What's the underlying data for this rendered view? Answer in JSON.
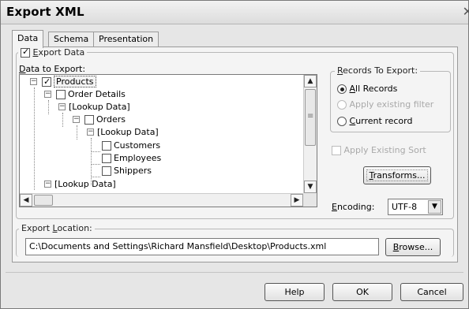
{
  "window": {
    "title": "Export XML",
    "close_glyph": "✕"
  },
  "tabs": [
    {
      "label": "Data",
      "active": true
    },
    {
      "label": "Schema",
      "active": false
    },
    {
      "label": "Presentation",
      "active": false
    }
  ],
  "export_data": {
    "label": "Export Data",
    "checked": true
  },
  "data_to_export": {
    "label": "Data to Export:",
    "tree": [
      {
        "label": "Products",
        "checked": true,
        "expander": "−"
      },
      {
        "label": "Order Details",
        "checked": false,
        "expander": "−"
      },
      {
        "label": "[Lookup Data]",
        "expander": "−"
      },
      {
        "label": "Orders",
        "checked": false,
        "expander": "−"
      },
      {
        "label": "[Lookup Data]",
        "expander": "−"
      },
      {
        "label": "Customers",
        "checked": false
      },
      {
        "label": "Employees",
        "checked": false
      },
      {
        "label": "Shippers",
        "checked": false
      },
      {
        "label": "[Lookup Data]",
        "expander": "−"
      }
    ]
  },
  "records_to_export": {
    "legend": "Records To Export:",
    "options": [
      {
        "label": "All Records",
        "selected": true,
        "enabled": true
      },
      {
        "label": "Apply existing filter",
        "selected": false,
        "enabled": false
      },
      {
        "label": "Current record",
        "selected": false,
        "enabled": true
      }
    ]
  },
  "apply_existing_sort": {
    "label": "Apply Existing Sort",
    "checked": false,
    "enabled": false
  },
  "transforms_button": {
    "label": "Transforms..."
  },
  "encoding": {
    "label": "Encoding:",
    "value": "UTF-8"
  },
  "export_location": {
    "legend": "Export Location:",
    "path": "C:\\Documents and Settings\\Richard Mansfield\\Desktop\\Products.xml",
    "browse_label": "Browse..."
  },
  "footer": {
    "help_label": "Help",
    "ok_label": "OK",
    "cancel_label": "Cancel"
  },
  "icons": {
    "scroll_up": "▲",
    "scroll_down": "▼",
    "scroll_left": "◀",
    "scroll_right": "▶",
    "dropdown": "▼",
    "grip": "≡"
  }
}
